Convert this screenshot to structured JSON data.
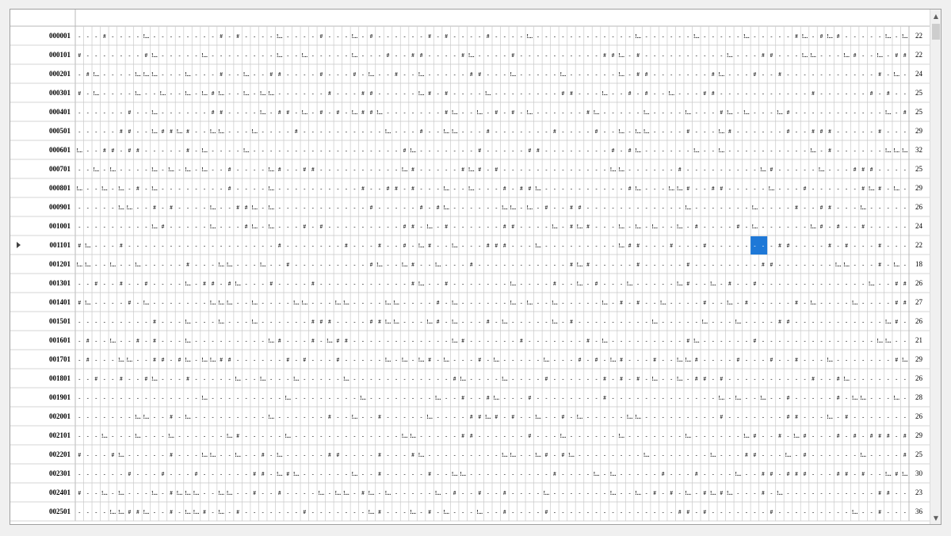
{
  "grid": {
    "rows": [
      {
        "id": "000001",
        "count": "22"
      },
      {
        "id": "000101",
        "count": "22"
      },
      {
        "id": "000201",
        "count": "24"
      },
      {
        "id": "000301",
        "count": "25"
      },
      {
        "id": "000401",
        "count": "25"
      },
      {
        "id": "000501",
        "count": "29"
      },
      {
        "id": "000601",
        "count": "32"
      },
      {
        "id": "000701",
        "count": "25"
      },
      {
        "id": "000801",
        "count": "29"
      },
      {
        "id": "000901",
        "count": "26"
      },
      {
        "id": "001001",
        "count": "24"
      },
      {
        "id": "001101",
        "count": "22"
      },
      {
        "id": "001201",
        "count": "18"
      },
      {
        "id": "001301",
        "count": "26"
      },
      {
        "id": "001401",
        "count": "27"
      },
      {
        "id": "001501",
        "count": "26"
      },
      {
        "id": "001601",
        "count": "21"
      },
      {
        "id": "001701",
        "count": "29"
      },
      {
        "id": "001801",
        "count": "26"
      },
      {
        "id": "001901",
        "count": "28"
      },
      {
        "id": "002001",
        "count": "26"
      },
      {
        "id": "002101",
        "count": "29"
      },
      {
        "id": "002201",
        "count": "25"
      },
      {
        "id": "002301",
        "count": "30"
      },
      {
        "id": "002401",
        "count": "23"
      },
      {
        "id": "002501",
        "count": "36"
      }
    ],
    "column_count": 100,
    "current_row_index": 11,
    "selection": {
      "row_index": 11,
      "columns": [
        81,
        82
      ]
    },
    "cell_symbols": {
      "empty": "-",
      "hit": "#",
      "partial": "!..."
    },
    "selection_color": "#1e78d7",
    "current_row_icon": "current-row-triangle-icon"
  },
  "scrollbar": {
    "up_icon": "▲",
    "down_icon": "▼"
  }
}
